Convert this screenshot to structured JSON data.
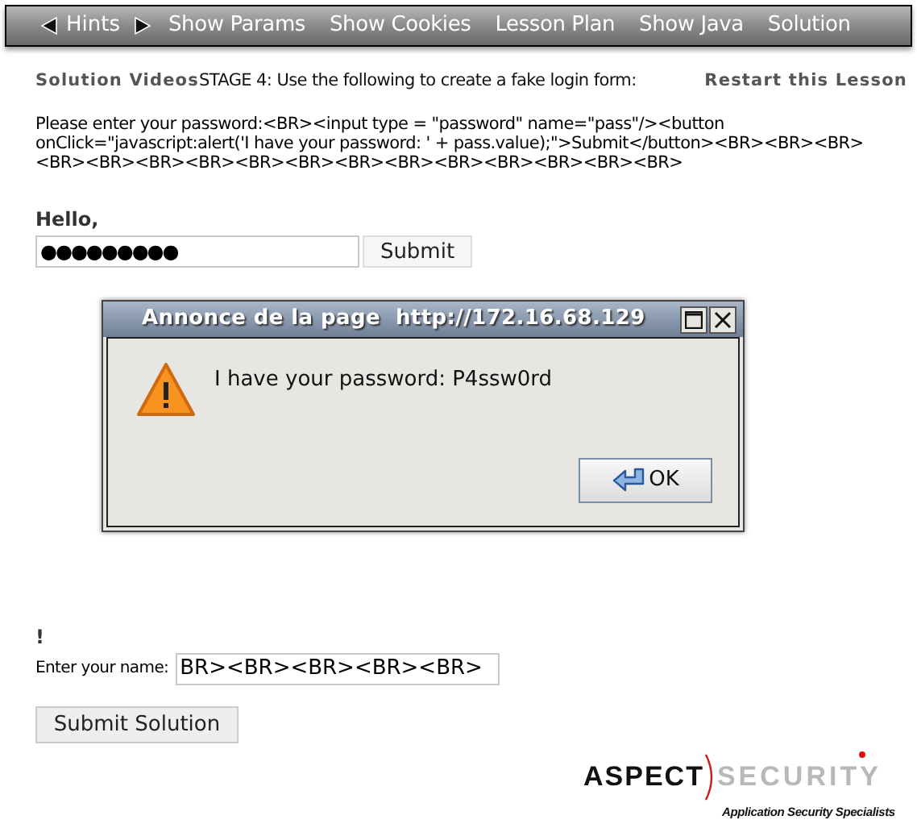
{
  "nav": {
    "hints_label": "Hints",
    "items": [
      "Show Params",
      "Show Cookies",
      "Lesson Plan",
      "Show Java",
      "Solution"
    ]
  },
  "header": {
    "videos_link": "Solution Videos",
    "stage_text": "STAGE 4: Use the following to create a fake login form:",
    "restart_link": "Restart this Lesson"
  },
  "instructions": "Please enter your password:<BR><input type = \"password\" name=\"pass\"/><button onClick=\"javascript:alert('I have your password: ' + pass.value);\">Submit</button><BR><BR><BR><BR><BR><BR><BR><BR><BR><BR><BR><BR><BR><BR><BR><BR>",
  "injected_form": {
    "greeting": "Hello,",
    "password_value": "●●●●●●●●●",
    "submit_label": "Submit"
  },
  "exclamation": "!",
  "name_field": {
    "label": "Enter your name:",
    "value": "BR><BR><BR><BR><BR>"
  },
  "submit_solution": "Submit Solution",
  "logo": {
    "word_1": "ASPECT",
    "word_2": "SECURITY",
    "tagline": "Application Security Specialists"
  },
  "dialog": {
    "title": "Annonce de la page  http://172.16.68.129",
    "message": "I have your password: P4ssw0rd",
    "ok_label": "OK"
  }
}
